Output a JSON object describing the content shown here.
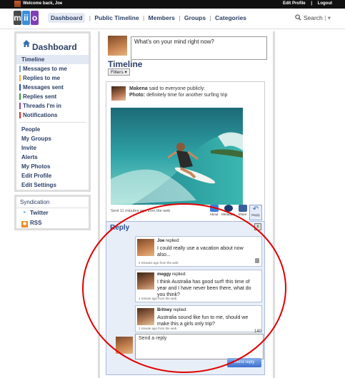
{
  "topbar": {
    "welcome": "Welcome back, Joe",
    "edit_profile": "Edit Profile",
    "sep": "|",
    "logout": "Logout"
  },
  "logo": {
    "letters": [
      "m",
      "ii",
      "o"
    ],
    "colors": [
      "#4a4a4a",
      "#3a8fd8",
      "#7f3fb7"
    ]
  },
  "nav": {
    "items": [
      "Dashboard",
      "Public Timeline",
      "Members",
      "Groups",
      "Categories"
    ],
    "separator": "|",
    "search_label": "Search",
    "search_icon": "search-icon"
  },
  "sidebar": {
    "title": "Dashboard",
    "icon": "house-icon",
    "items": [
      {
        "label": "Timeline",
        "color": ""
      },
      {
        "label": "Messages to me",
        "color": "#7da0e0"
      },
      {
        "label": "Replies to me",
        "color": "#f3b040"
      },
      {
        "label": "Messages sent",
        "color": "#2a56a8"
      },
      {
        "label": "Replies sent",
        "color": "#3b9a3b"
      },
      {
        "label": "Threads I'm in",
        "color": "#8b4bb0"
      },
      {
        "label": "Notifications",
        "color": "#d9302a"
      }
    ],
    "items2": [
      "People",
      "My Groups",
      "Invite",
      "Alerts",
      "My Photos",
      "Edit Profile",
      "Edit Settings"
    ]
  },
  "syndication": {
    "title": "Syndication",
    "items": [
      {
        "label": "Twitter",
        "icon": "twitter-icon"
      },
      {
        "label": "RSS",
        "icon": "rss-icon"
      }
    ]
  },
  "composer": {
    "placeholder": "What's on your mind right now?"
  },
  "timeline": {
    "title": "Timeline",
    "filters_label": "Filters ▾"
  },
  "post": {
    "author": "Makena",
    "said": "said to everyone publicly:",
    "photo_label": "Photo:",
    "photo_caption": "definitely time for another surfing trip",
    "meta": "Sent 11 minutes ago from the web",
    "actions": [
      "About",
      "Metadata",
      "Share",
      "Reply"
    ],
    "reply_count": "3"
  },
  "reply_panel": {
    "title": "Reply",
    "close": "x",
    "replies": [
      {
        "name": "Joe",
        "verb": "replied:",
        "text": "I could really use a vacation about now also...",
        "meta": "4 minutes ago from the web"
      },
      {
        "name": "meggy",
        "verb": "replied:",
        "text": "I think Australia has good surf! this time of year and I have never been there, what do you think?",
        "meta": "1 minute ago from the web"
      },
      {
        "name": "Britney",
        "verb": "replied:",
        "text": "Australia sound like fun to me, should we make this a girls only trip?",
        "meta": "1 minute ago from the web"
      }
    ],
    "char_count": "140",
    "send_placeholder": "Send a reply",
    "send_button": "Send reply"
  },
  "colors": {
    "accent": "#2a3f66",
    "panel": "#e8eef8",
    "annotation": "#e00000"
  }
}
